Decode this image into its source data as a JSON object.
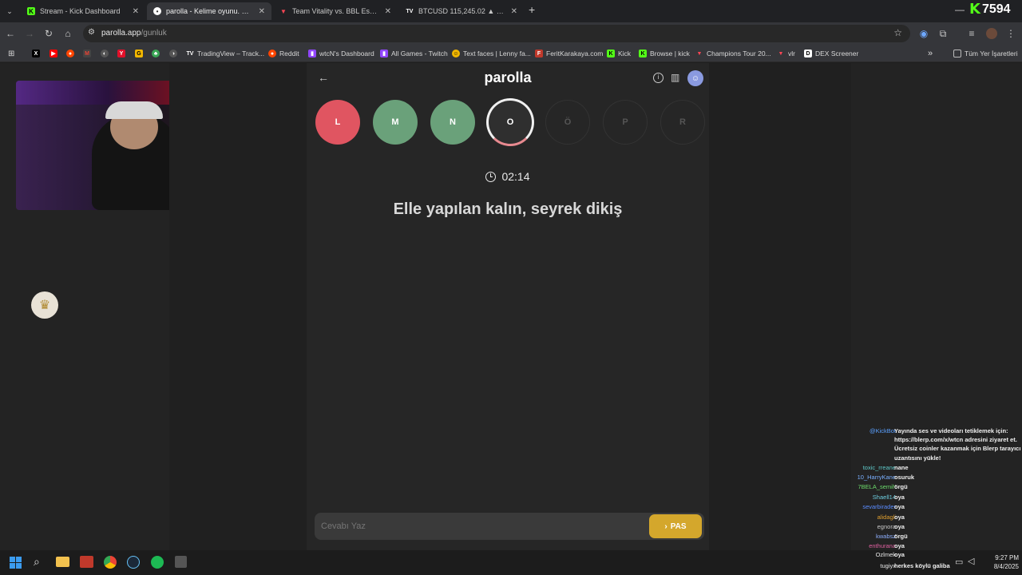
{
  "browser": {
    "tabs": [
      {
        "title": "Stream - Kick Dashboard",
        "icon": "kick-icon",
        "color": "#53fc18"
      },
      {
        "title": "parolla - Kelime oyunu. Günlük",
        "icon": "parolla-icon",
        "color": "#ffffff"
      },
      {
        "title": "Team Vitality vs. BBL Esports | V",
        "icon": "valorant-icon",
        "color": "#ff4655"
      },
      {
        "title": "BTCUSD 115,245.02 ▲ +0.9% U",
        "icon": "tradingview-icon",
        "color": "#ffffff"
      }
    ],
    "new_tab": "+",
    "url": "parolla.app",
    "url_path": "/gunluk",
    "bookmarks": [
      {
        "label": "TradingView – Track..."
      },
      {
        "label": "Reddit"
      },
      {
        "label": "wtcN's Dashboard"
      },
      {
        "label": "All Games - Twitch"
      },
      {
        "label": "Text faces | Lenny fa..."
      },
      {
        "label": "FeritKarakaya.com"
      },
      {
        "label": "Kick"
      },
      {
        "label": "Browse | kick"
      },
      {
        "label": "Champions Tour 20..."
      },
      {
        "label": "vlr"
      },
      {
        "label": "DEX Screener"
      }
    ],
    "bookmarks_more": "»",
    "all_bookmarks": "Tüm Yer İşaretleri"
  },
  "overlay": {
    "kick_count": "7594"
  },
  "game": {
    "title": "parolla",
    "letters": [
      {
        "letter": "L",
        "state": "wrong",
        "color": "#e05561"
      },
      {
        "letter": "M",
        "state": "correct",
        "color": "#6aa17a"
      },
      {
        "letter": "N",
        "state": "correct",
        "color": "#6aa17a"
      },
      {
        "letter": "O",
        "state": "current",
        "color": "#2f2f2f"
      },
      {
        "letter": "Ö",
        "state": "pending",
        "color": "#2a2a2a"
      },
      {
        "letter": "P",
        "state": "pending",
        "color": "#2a2a2a"
      },
      {
        "letter": "R",
        "state": "pending",
        "color": "#2a2a2a"
      }
    ],
    "timer": "02:14",
    "question": "Elle yapılan kalın, seyrek dikiş",
    "answer_placeholder": "Cevabı Yaz",
    "pass_label": "PAS",
    "pass_color": "#d4a72c"
  },
  "chat": [
    {
      "user": "@KickBot",
      "color": "#5aa0ff",
      "msg": "Yayında ses ve videoları tetiklemek için:"
    },
    {
      "user": "",
      "color": "#5aa0ff",
      "msg": "https://blerp.com/x/wtcn adresini ziyaret et."
    },
    {
      "user": "",
      "color": "#5aa0ff",
      "msg": "Ücretsiz coinler kazanmak için Blerp tarayıcı"
    },
    {
      "user": "",
      "color": "#5aa0ff",
      "msg": "uzantısını yükle!"
    },
    {
      "user": "toxic_rreane",
      "color": "#5ec8c8",
      "msg": "nane"
    },
    {
      "user": "10_HarryKane",
      "color": "#7ab0ff",
      "msg": "osuruk"
    },
    {
      "user": "7BELA_semih",
      "color": "#6cdc6c",
      "msg": "örgü"
    },
    {
      "user": "Shaell14",
      "color": "#6ecfe0",
      "msg": "oya"
    },
    {
      "user": "sevarbirader",
      "color": "#5a8cff",
      "msg": "oya"
    },
    {
      "user": "alidagli",
      "color": "#e0a030",
      "msg": "oya"
    },
    {
      "user": "egnora",
      "color": "#c8c8c8",
      "msg": "oya"
    },
    {
      "user": "kwabsz",
      "color": "#8fb0ff",
      "msg": "örgü"
    },
    {
      "user": "enthurana",
      "color": "#e060a0",
      "msg": "oya"
    },
    {
      "user": "Ozlmek",
      "color": "#e8e8e8",
      "msg": "oya"
    },
    {
      "user": "tugiyx",
      "color": "#e8e8e8",
      "msg": "herkes köylü galiba"
    }
  ],
  "taskbar": {
    "time": "9:27 PM",
    "date": "8/4/2025"
  }
}
